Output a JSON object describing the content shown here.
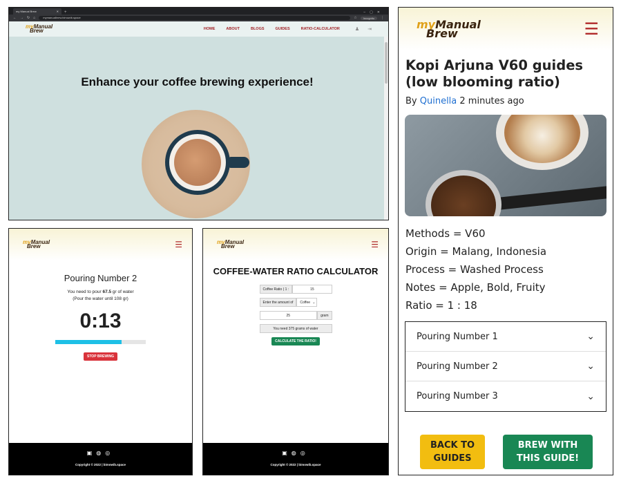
{
  "desktop": {
    "browser": {
      "tab_title": "my Manual Brew",
      "url": "mymanualbrew.bimowib.space",
      "incognito_label": "Incognito"
    },
    "logo": {
      "my": "my",
      "text_1": "Manual",
      "text_2": "Brew"
    },
    "nav": [
      "HOME",
      "ABOUT",
      "BLOGS",
      "GUIDES",
      "RATIO-CALCULATOR"
    ],
    "hero_heading": "Enhance your coffee brewing experience!"
  },
  "timer_screen": {
    "logo": {
      "my": "my",
      "text_1": "Manual",
      "text_2": "Brew"
    },
    "title": "Pouring Number 2",
    "instruction_prefix": "You need to pour ",
    "instruction_amount": "67.5",
    "instruction_suffix": " gr of water",
    "instruction_note": "(Pour the water until 108 gr)",
    "clock": "0:13",
    "progress_fraction": 0.73,
    "stop_button": "STOP BREWING",
    "footer_copy": "Copyright © 2022 | bimowib.space"
  },
  "calculator_screen": {
    "logo": {
      "my": "my",
      "text_1": "Manual",
      "text_2": "Brew"
    },
    "title": "COFFEE-WATER RATIO CALCULATOR",
    "ratio_label": "Coffee Ratio ( 1 :",
    "ratio_value": "15",
    "amount_label": "Enter the amount of",
    "amount_select": "Coffee",
    "amount_value": "25",
    "unit": "gram",
    "result": "You need 375 grams of water",
    "button": "CALCULATE THE RATIO!",
    "footer_copy": "Copyright © 2022 | bimowib.space"
  },
  "guide_screen": {
    "logo": {
      "my": "my",
      "text_1": "Manual",
      "text_2": "Brew"
    },
    "title": "Kopi Arjuna V60 guides (low blooming ratio)",
    "by_prefix": "By ",
    "author": "Quinella",
    "time_ago": " 2 minutes ago",
    "info": [
      "Methods = V60",
      "Origin = Malang, Indonesia",
      "Process = Washed Process",
      "Notes = Apple, Bold, Fruity",
      "Ratio = 1 : 18"
    ],
    "pourings": [
      "Pouring Number 1",
      "Pouring Number 2",
      "Pouring Number 3"
    ],
    "back_button_line1": "BACK TO",
    "back_button_line2": "GUIDES",
    "brew_button_line1": "BREW WITH",
    "brew_button_line2": "THIS GUIDE!"
  },
  "colors": {
    "brand_red": "#a11f24",
    "accent_cyan": "#1ec0e6",
    "danger": "#d9333b",
    "success": "#198754",
    "warning": "#f2bd10",
    "link": "#1f6fd1"
  }
}
